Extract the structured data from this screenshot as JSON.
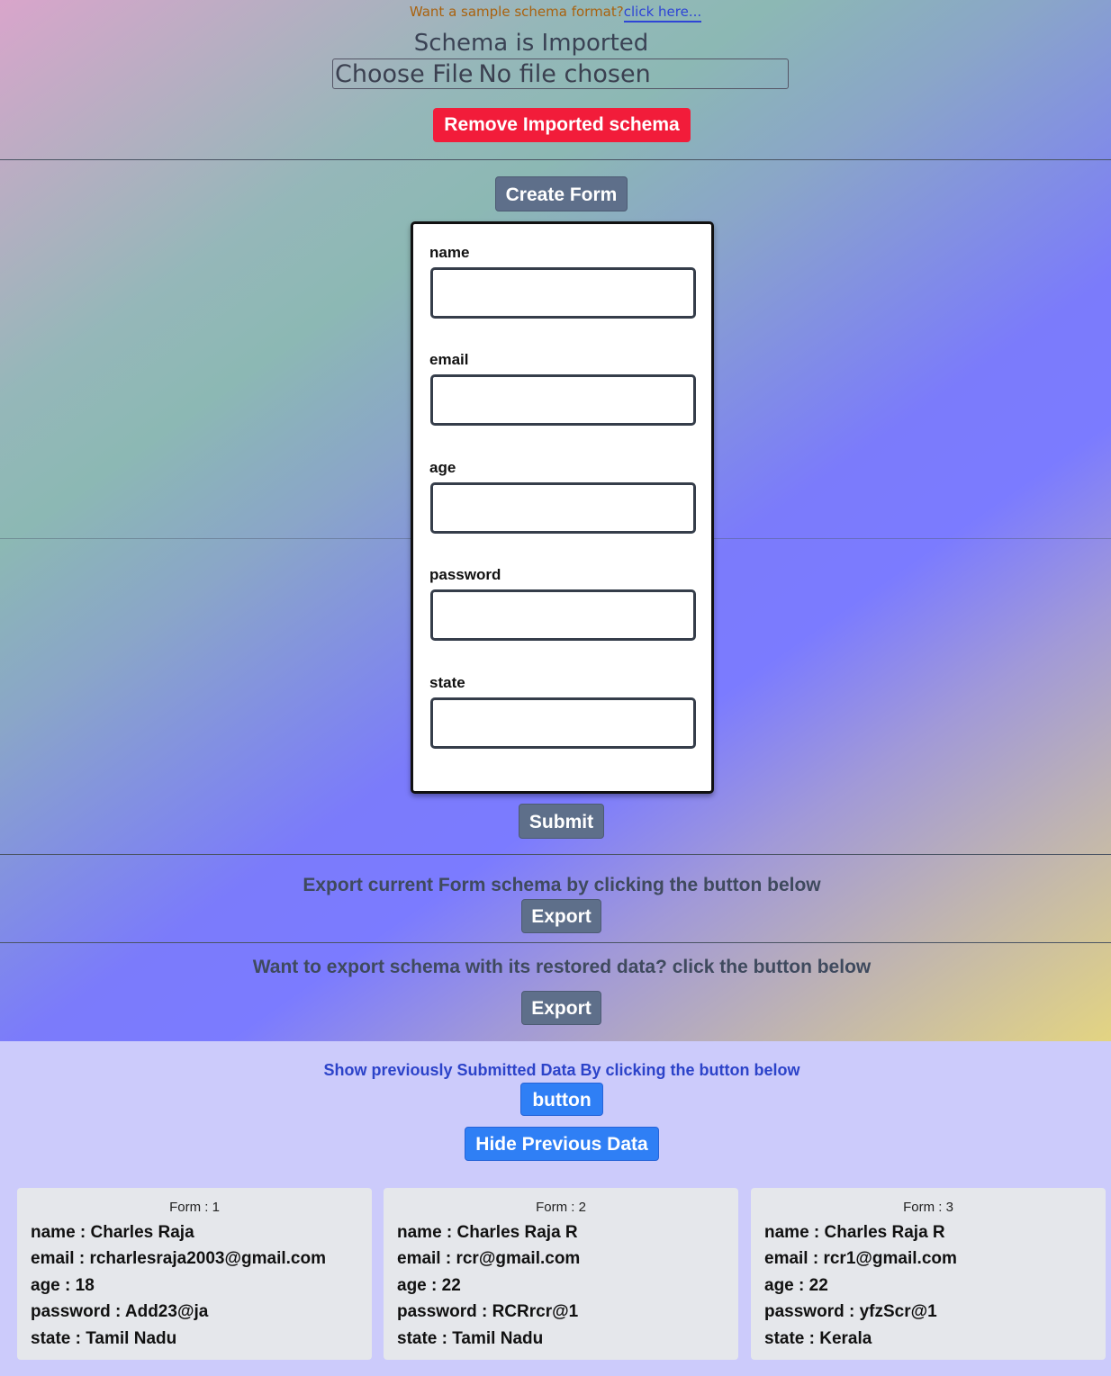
{
  "header": {
    "sample_prompt": "Want a sample schema format?",
    "sample_link": "click here...",
    "schema_status": "Schema is Imported",
    "file_input": {
      "button_label": "Choose File",
      "status": "No file chosen"
    },
    "remove_button": "Remove Imported schema"
  },
  "form_builder": {
    "create_button": "Create Form",
    "fields": [
      {
        "label": "name",
        "value": ""
      },
      {
        "label": "email",
        "value": ""
      },
      {
        "label": "age",
        "value": ""
      },
      {
        "label": "password",
        "value": ""
      },
      {
        "label": "state",
        "value": ""
      }
    ],
    "submit_button": "Submit"
  },
  "export": {
    "schema_text": "Export current Form schema by clicking the button below",
    "schema_button": "Export",
    "data_text": "Want to export schema with its restored data? click the button below",
    "data_button": "Export"
  },
  "previous_data": {
    "prompt": "Show previously Submitted Data By clicking the button below",
    "show_button": "button",
    "hide_button": "Hide Previous Data",
    "forms": [
      {
        "title": "Form : 1",
        "rows": [
          "name : Charles Raja",
          "email : rcharlesraja2003@gmail.com",
          "age : 18",
          "password : Add23@ja",
          "state : Tamil Nadu"
        ]
      },
      {
        "title": "Form : 2",
        "rows": [
          "name : Charles Raja R",
          "email : rcr@gmail.com",
          "age : 22",
          "password : RCRrcr@1",
          "state : Tamil Nadu"
        ]
      },
      {
        "title": "Form : 3",
        "rows": [
          "name : Charles Raja R",
          "email : rcr1@gmail.com",
          "age : 22",
          "password : yfzScr@1",
          "state : Kerala"
        ]
      }
    ]
  },
  "colors": {
    "remove_button": "#f21c3a",
    "slate_button": "#5e6f8a",
    "blue_button": "#2f7ff5",
    "lower_background": "#cccbfb",
    "card_background": "#e5e7eb"
  }
}
